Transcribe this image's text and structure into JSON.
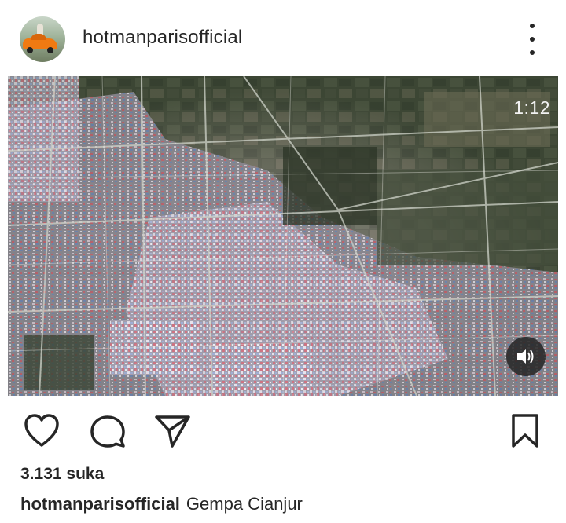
{
  "post": {
    "username": "hotmanparisofficial",
    "avatar_icon": "profile-avatar",
    "more_icon": "more-options-icon"
  },
  "video": {
    "timer": "1:12",
    "mute_icon": "speaker-volume-icon",
    "content": "aerial-satellite-view"
  },
  "actions": {
    "like_icon": "heart-icon",
    "comment_icon": "comment-icon",
    "share_icon": "share-send-icon",
    "save_icon": "bookmark-icon"
  },
  "likes": "3.131 suka",
  "caption": {
    "user": "hotmanparisofficial",
    "text": "Gempa Cianjur"
  },
  "colors": {
    "text": "#262626",
    "background": "#ffffff",
    "video_bg": "#000000"
  }
}
